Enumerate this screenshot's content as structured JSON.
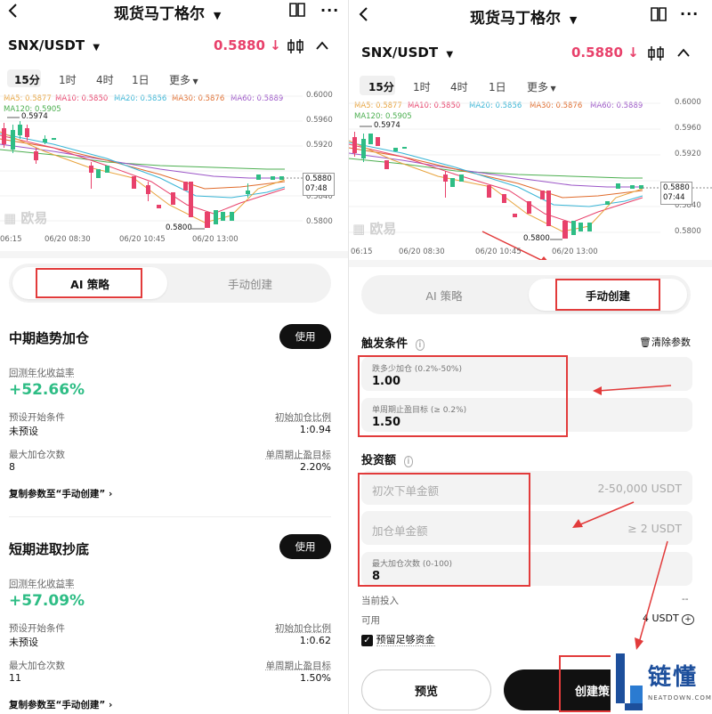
{
  "left": {
    "header": {
      "title": "现货马丁格尔"
    },
    "pair": {
      "name": "SNX/USDT",
      "price": "0.5880",
      "arrow": "↓"
    },
    "timeframes": [
      "15分",
      "1时",
      "4时",
      "1日",
      "更多"
    ],
    "ma_legend": [
      "MA5: 0.5877",
      "MA10: 0.5850",
      "MA20: 0.5856",
      "MA30: 0.5876",
      "MA60: 0.5889",
      "MA120: 0.5905"
    ],
    "y_ticks": [
      "0.6000",
      "0.5960",
      "0.5920",
      "0.5880",
      "0.5840",
      "0.5800"
    ],
    "x_ticks": [
      "06:15",
      "06/20 08:30",
      "06/20 10:45",
      "06/20 13:00"
    ],
    "high_label": "0.5974",
    "low_label": "0.5800",
    "price_tag": "0.5880",
    "countdown": "07:48",
    "watermark": "欧易",
    "tabs": {
      "ai": "AI 策略",
      "manual": "手动创建"
    },
    "cards": [
      {
        "title": "中期趋势加仓",
        "use": "使用",
        "ret_label": "回测年化收益率",
        "ret": "+52.66%",
        "start_label": "预设开始条件",
        "start_val": "未预设",
        "ratio_label": "初始加仓比例",
        "ratio_val": "1:0.94",
        "max_label": "最大加仓次数",
        "max_val": "8",
        "tp_label": "单周期止盈目标",
        "tp_val": "2.20%",
        "copy": "复制参数至“手动创建”"
      },
      {
        "title": "短期进取抄底",
        "use": "使用",
        "ret_label": "回测年化收益率",
        "ret": "+57.09%",
        "start_label": "预设开始条件",
        "start_val": "未预设",
        "ratio_label": "初始加仓比例",
        "ratio_val": "1:0.62",
        "max_label": "最大加仓次数",
        "max_val": "11",
        "tp_label": "单周期止盈目标",
        "tp_val": "1.50%",
        "copy": "复制参数至“手动创建”"
      }
    ]
  },
  "right": {
    "header": {
      "title": "现货马丁格尔"
    },
    "pair": {
      "name": "SNX/USDT",
      "price": "0.5880",
      "arrow": "↓"
    },
    "timeframes": [
      "15分",
      "1时",
      "4时",
      "1日",
      "更多"
    ],
    "ma_legend": [
      "MA5: 0.5877",
      "MA10: 0.5850",
      "MA20: 0.5856",
      "MA30: 0.5876",
      "MA60: 0.5889",
      "MA120: 0.5905"
    ],
    "y_ticks": [
      "0.6000",
      "0.5960",
      "0.5920",
      "0.5880",
      "0.5840",
      "0.5800"
    ],
    "x_ticks": [
      "06:15",
      "06/20 08:30",
      "06/20 10:45",
      "06/20 13:00"
    ],
    "high_label": "0.5974",
    "low_label": "0.5800",
    "price_tag": "0.5880",
    "countdown": "07:44",
    "watermark": "欧易",
    "tabs": {
      "ai": "AI 策略",
      "manual": "手动创建"
    },
    "trigger": {
      "title": "触发条件",
      "clear": "清除参数",
      "drop_label": "跌多少加仓 (0.2%-50%)",
      "drop_val": "1.00",
      "tp_label": "单周期止盈目标 (≥ 0.2%)",
      "tp_val": "1.50"
    },
    "invest": {
      "title": "投资额",
      "first_ph": "初次下单金额",
      "first_hint": "2-50,000 USDT",
      "add_ph": "加仓单金额",
      "add_hint": "≥ 2 USDT",
      "max_label": "最大加仓次数 (0-100)",
      "max_val": "8",
      "current_label": "当前投入",
      "current_val": "--",
      "avail_label": "可用",
      "avail_val": "4 USDT",
      "reserve": "预留足够资金"
    },
    "buttons": {
      "preview": "预览",
      "create": "创建策"
    },
    "watermark_logo": {
      "brand": "链懂",
      "site": "NEATDOWN.COM"
    }
  },
  "colors": {
    "green": "#2ebd85",
    "red": "#e8416b",
    "annotation": "#e23b3b",
    "ma5": "#e8a33c",
    "ma10": "#e8416b",
    "ma20": "#38b5d6",
    "ma30": "#e06b2b",
    "ma60": "#9b55c7",
    "ma120": "#4caf50"
  }
}
